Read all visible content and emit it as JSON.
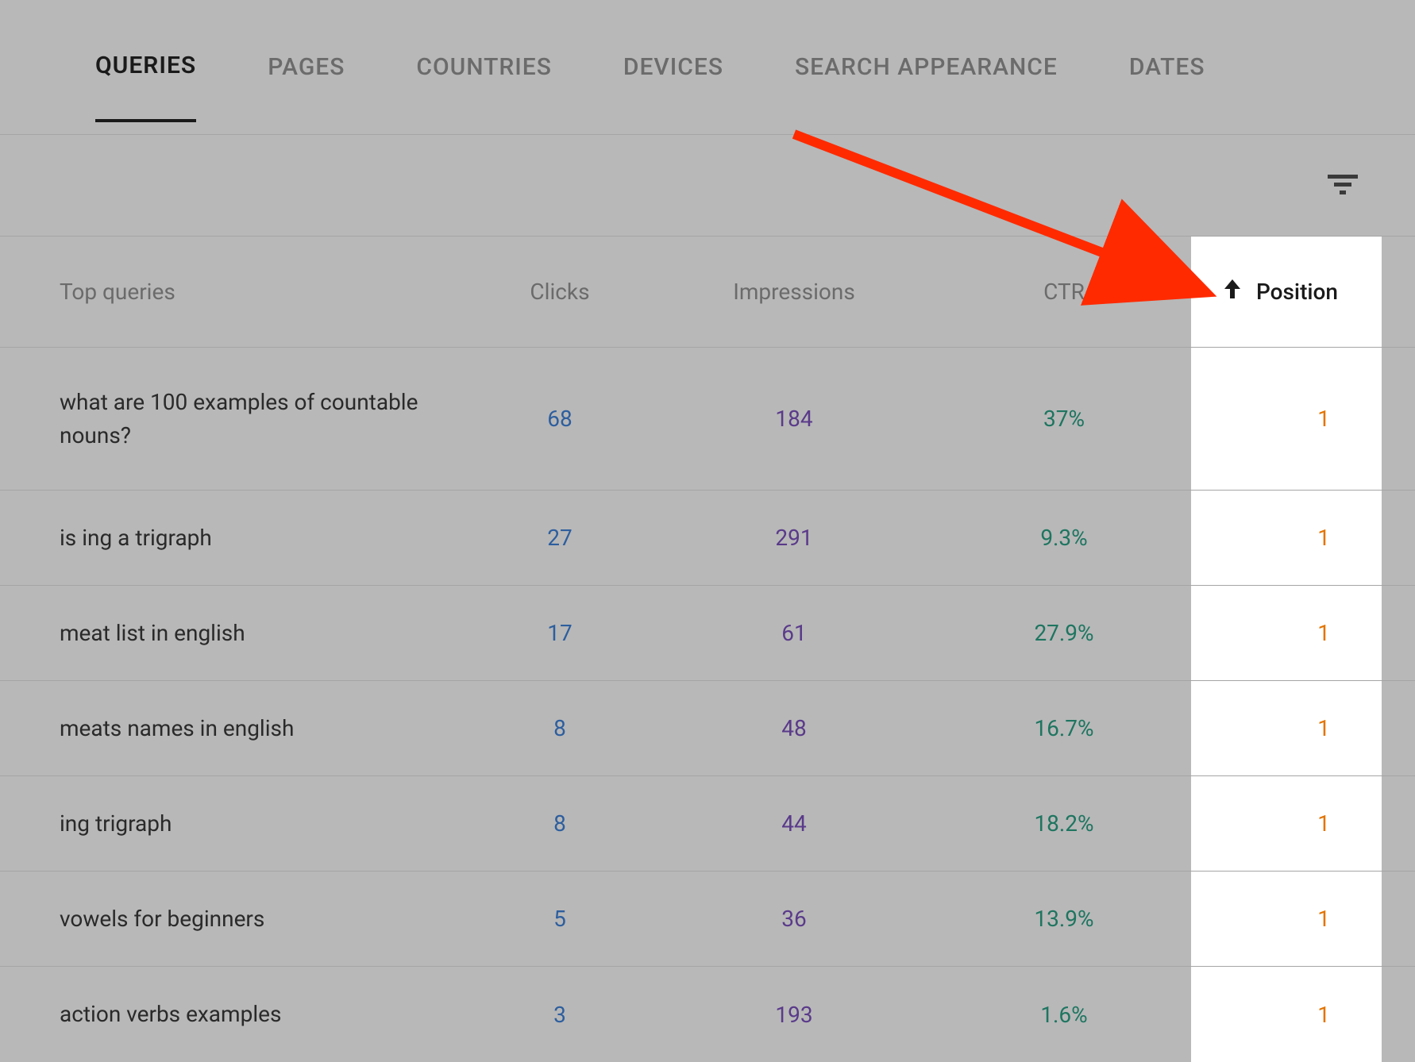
{
  "tabs": [
    {
      "label": "QUERIES",
      "active": true
    },
    {
      "label": "PAGES",
      "active": false
    },
    {
      "label": "COUNTRIES",
      "active": false
    },
    {
      "label": "DEVICES",
      "active": false
    },
    {
      "label": "SEARCH APPEARANCE",
      "active": false
    },
    {
      "label": "DATES",
      "active": false
    }
  ],
  "columns": {
    "query": "Top queries",
    "clicks": "Clicks",
    "impressions": "Impressions",
    "ctr": "CTR",
    "position": "Position"
  },
  "sort": {
    "column": "position",
    "direction": "asc"
  },
  "rows": [
    {
      "query": "what are 100 examples of countable nouns?",
      "clicks": "68",
      "impressions": "184",
      "ctr": "37%",
      "position": "1"
    },
    {
      "query": "is ing a trigraph",
      "clicks": "27",
      "impressions": "291",
      "ctr": "9.3%",
      "position": "1"
    },
    {
      "query": "meat list in english",
      "clicks": "17",
      "impressions": "61",
      "ctr": "27.9%",
      "position": "1"
    },
    {
      "query": "meats names in english",
      "clicks": "8",
      "impressions": "48",
      "ctr": "16.7%",
      "position": "1"
    },
    {
      "query": "ing trigraph",
      "clicks": "8",
      "impressions": "44",
      "ctr": "18.2%",
      "position": "1"
    },
    {
      "query": "vowels for beginners",
      "clicks": "5",
      "impressions": "36",
      "ctr": "13.9%",
      "position": "1"
    },
    {
      "query": "action verbs examples",
      "clicks": "3",
      "impressions": "193",
      "ctr": "1.6%",
      "position": "1"
    }
  ],
  "colors": {
    "clicks": "#2d5e9e",
    "impressions": "#5a3a8a",
    "ctr": "#1e7560",
    "position": "#e37400"
  }
}
